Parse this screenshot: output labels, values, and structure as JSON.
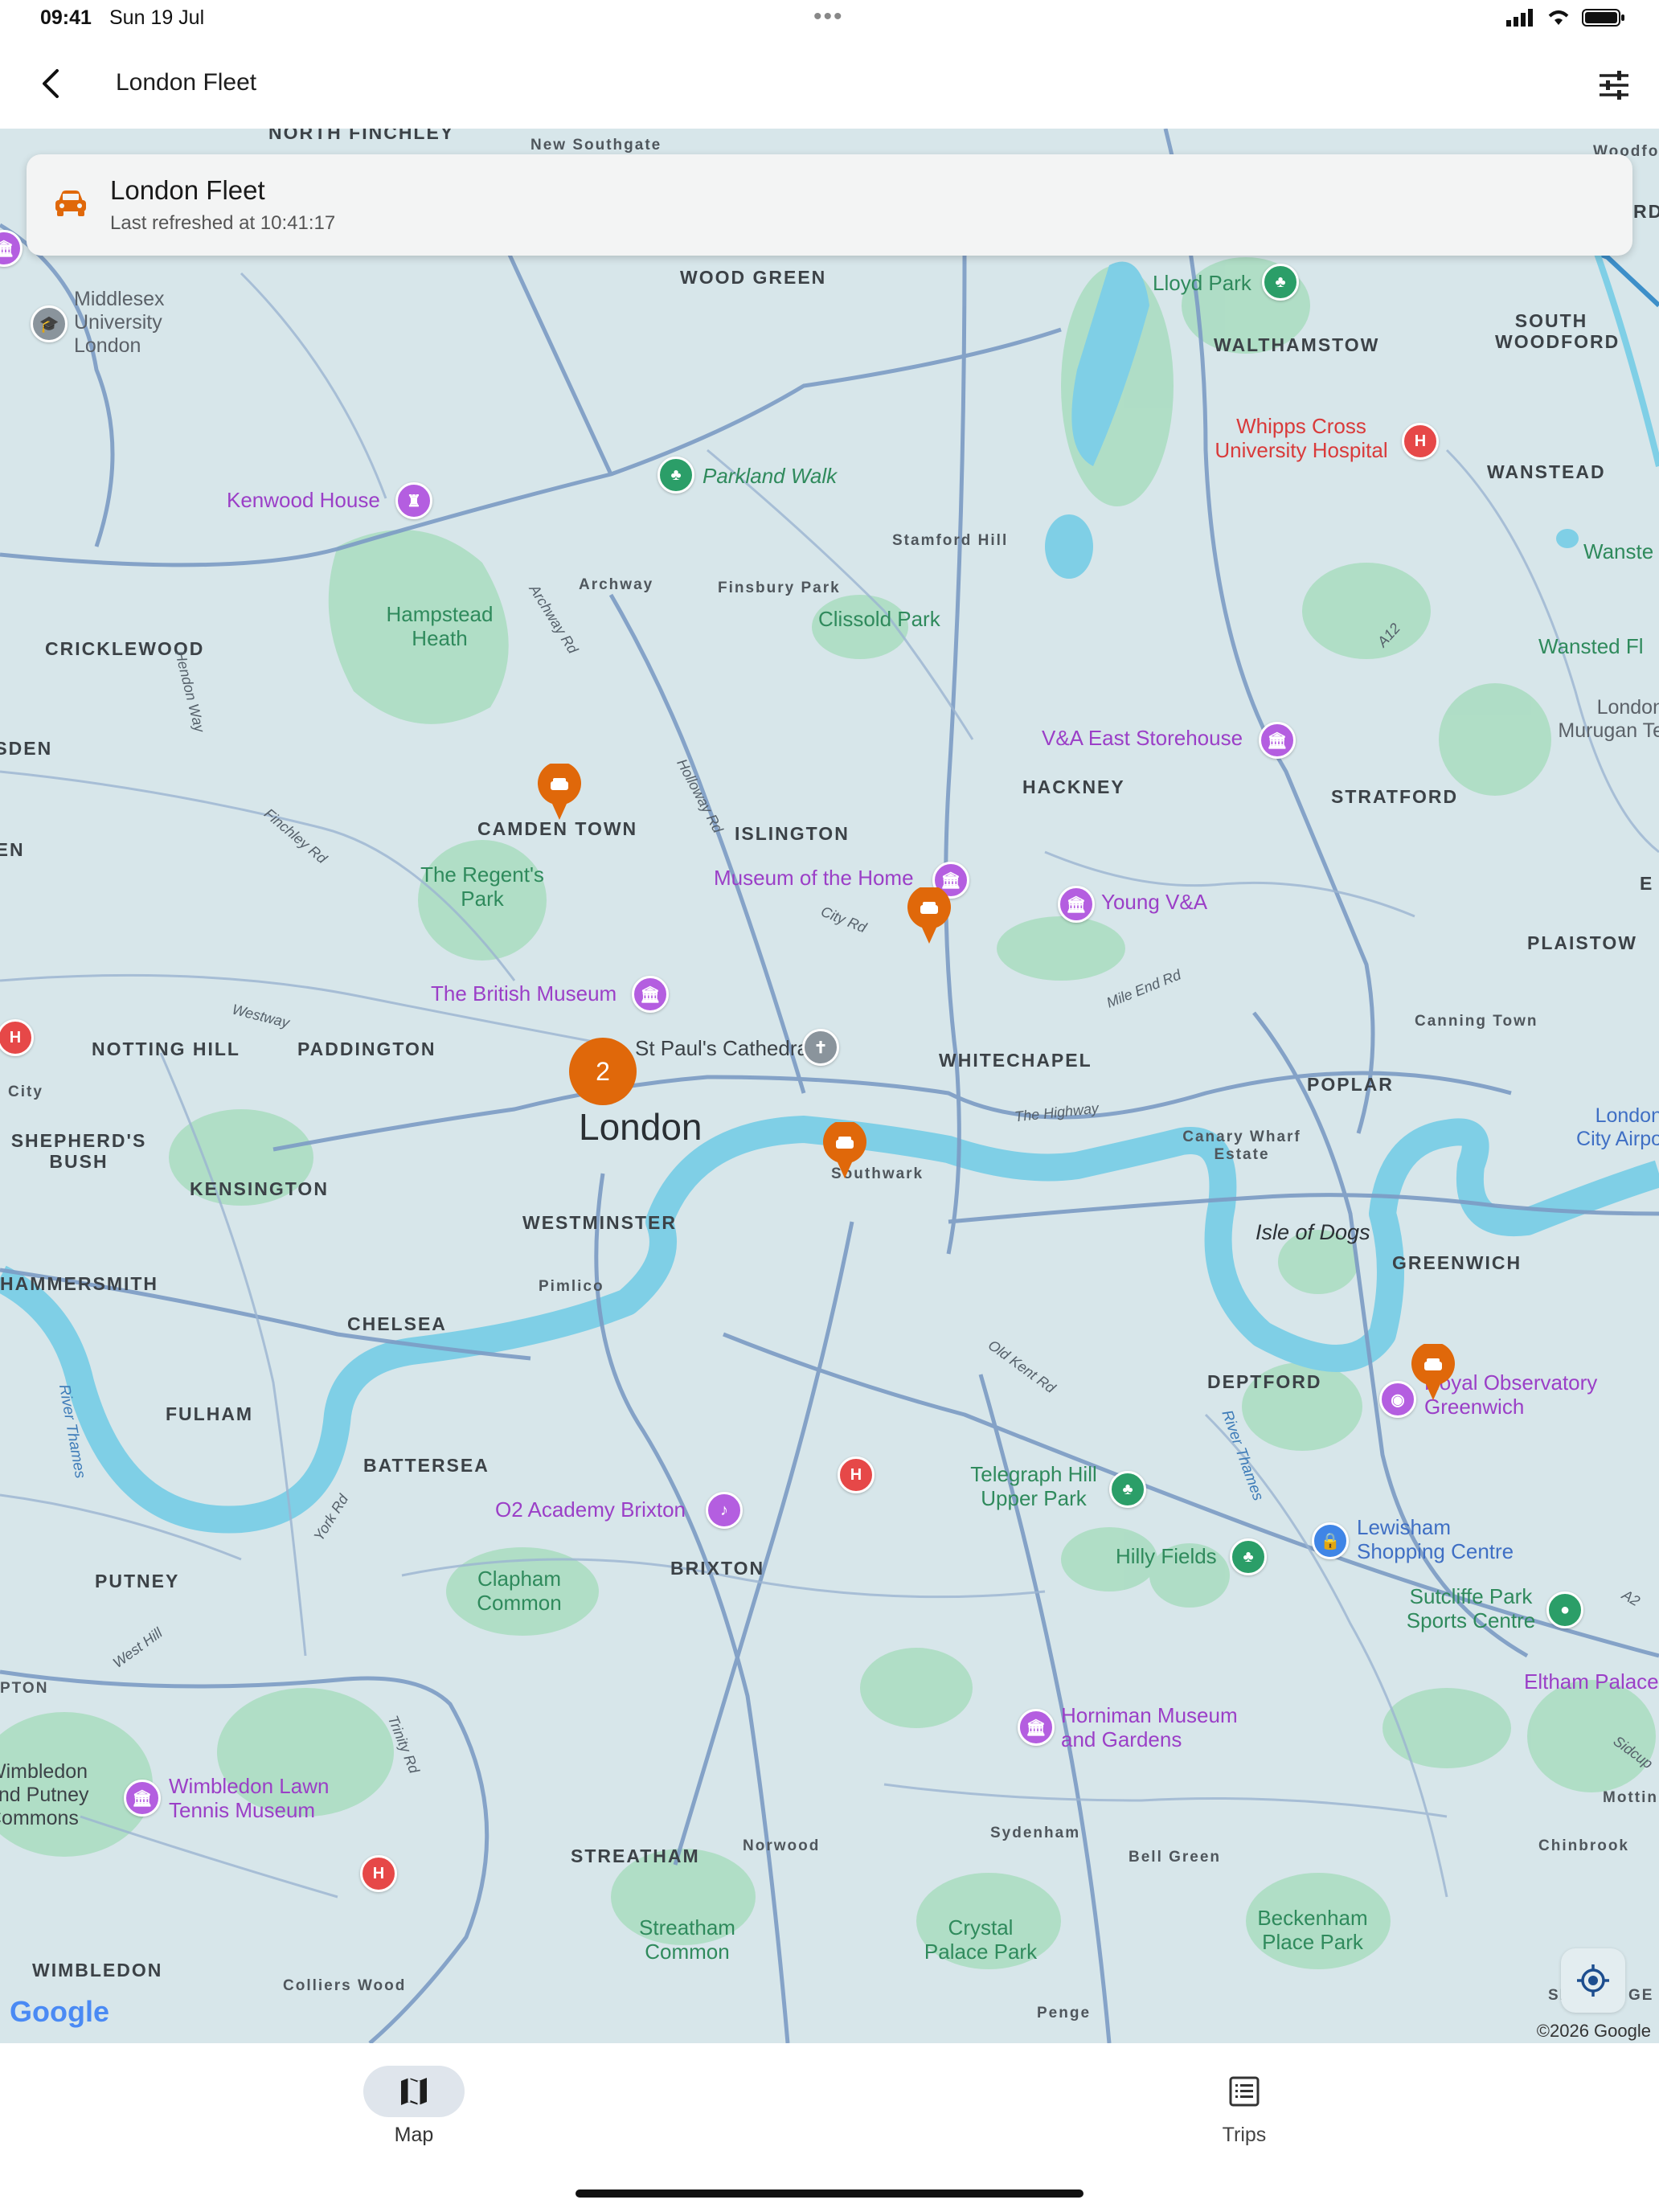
{
  "status_bar": {
    "time": "09:41",
    "date": "Sun 19 Jul"
  },
  "app_bar": {
    "title": "London Fleet"
  },
  "info_card": {
    "title": "London Fleet",
    "subtitle": "Last refreshed at 10:41:17"
  },
  "map": {
    "city_label": "London",
    "cluster_count": "2",
    "districts": [
      "North Finchley",
      "New Southgate",
      "Wood Green",
      "Walthamstow",
      "South Woodford",
      "Wanstead",
      "Stamford Hill",
      "Archway",
      "Finsbury Park",
      "Cricklewood",
      "Hackney",
      "Stratford",
      "Camden Town",
      "Islington",
      "Plaistow",
      "Notting Hill",
      "Paddington",
      "Whitechapel",
      "Canning Town",
      "Poplar",
      "Shepherd's Bush",
      "Kensington",
      "Southwark",
      "Canary Wharf Estate",
      "Westminster",
      "Hammersmith",
      "Pimlico",
      "Chelsea",
      "Greenwich",
      "Fulham",
      "Deptford",
      "Battersea",
      "Brixton",
      "Putney",
      "Sydenham",
      "Bell Green",
      "Chinbrook",
      "Streatham",
      "Norwood",
      "Wimbledon",
      "Colliers Wood",
      "Penge",
      "Mottin",
      "Esden",
      "Den"
    ],
    "parks": [
      "Lloyd Park",
      "Parkland Walk",
      "Hampstead Heath",
      "Clissold Park",
      "The Regent's Park",
      "Telegraph Hill Upper Park",
      "Hilly Fields",
      "Clapham Common",
      "Streatham Common",
      "Crystal Palace Park",
      "Beckenham Place Park"
    ],
    "pois": [
      "Middlesex University London",
      "Kenwood House",
      "V&A East Storehouse",
      "Museum of the Home",
      "Young V&A",
      "The British Museum",
      "St Paul's Cathedral",
      "Royal Observatory Greenwich",
      "O2 Academy Brixton",
      "Lewisham Shopping Centre",
      "Sutcliffe Park Sports Centre",
      "Horniman Museum and Gardens",
      "Wimbledon Lawn Tennis Museum",
      "Eltham Palace",
      "Whipps Cross University Hospital"
    ],
    "roads": [
      "Archway Rd",
      "Hendon Way",
      "Finchley Rd",
      "Holloway Rd",
      "City Rd",
      "Westway",
      "Mile End Rd",
      "The Highway",
      "Old Kent Rd",
      "York Rd",
      "West Hill",
      "Trinity Rd",
      "A12",
      "Sidcup",
      "A2"
    ],
    "water": [
      "River Thames",
      "Isle of Dogs"
    ],
    "edge_labels": [
      "Wansted Fl",
      "Wanste",
      "London Murugan Te",
      "London City Airpo",
      "Woodford Een",
      "RD",
      "E",
      "City",
      "Wimbledon and Putney Commons",
      "PTON",
      "SI",
      "GE"
    ],
    "vehicles_shown": 5,
    "google_logo": "Google",
    "copyright": "©2026 Google"
  },
  "bottom_nav": {
    "tabs": [
      {
        "label": "Map",
        "selected": true,
        "icon": "map-icon"
      },
      {
        "label": "Trips",
        "selected": false,
        "icon": "list-icon"
      }
    ]
  },
  "colors": {
    "accent": "#e0680a",
    "park_green": "#2f8a5c",
    "poi_purple": "#9b3fc7",
    "hospital_red": "#d93a3a",
    "water": "#7fcfe6"
  }
}
